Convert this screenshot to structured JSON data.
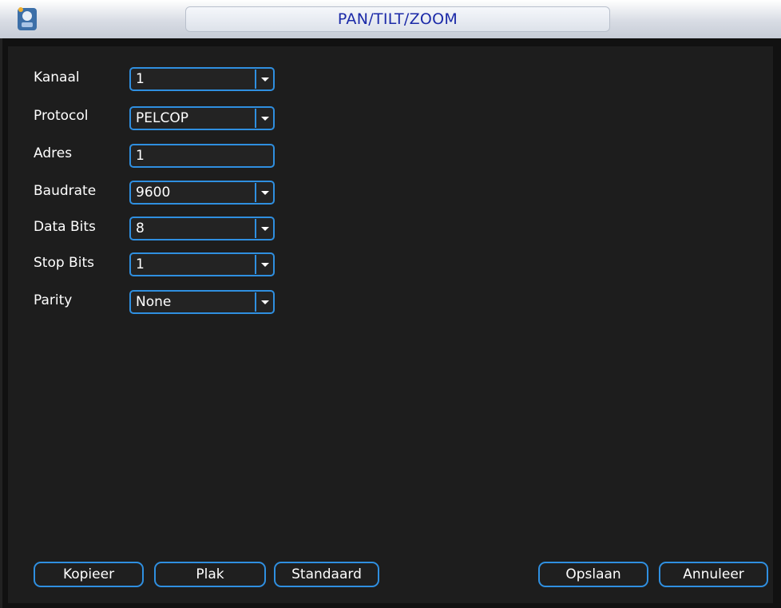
{
  "window": {
    "title": "PAN/TILT/ZOOM",
    "icon": "ptz-app-icon"
  },
  "form": {
    "channel": {
      "label": "Kanaal",
      "value": "1"
    },
    "protocol": {
      "label": "Protocol",
      "value": "PELCOP"
    },
    "address": {
      "label": "Adres",
      "value": "1"
    },
    "baudrate": {
      "label": "Baudrate",
      "value": "9600"
    },
    "data_bits": {
      "label": "Data Bits",
      "value": "8"
    },
    "stop_bits": {
      "label": "Stop Bits",
      "value": "1"
    },
    "parity": {
      "label": "Parity",
      "value": "None"
    }
  },
  "buttons": {
    "copy": "Kopieer",
    "paste": "Plak",
    "default": "Standaard",
    "save": "Opslaan",
    "cancel": "Annuleer"
  },
  "colors": {
    "accent": "#2f8fe0",
    "title_text": "#1b2aa8",
    "background": "#1d1d1d"
  }
}
